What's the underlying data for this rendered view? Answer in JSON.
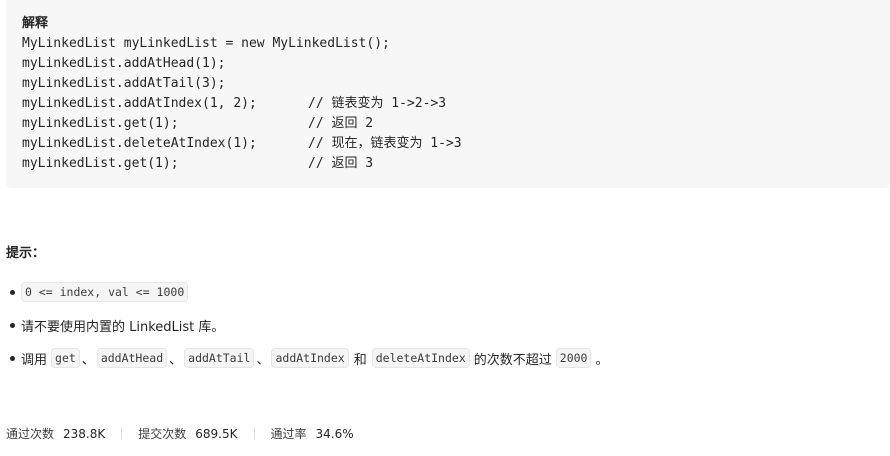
{
  "code_block": {
    "title": "解释",
    "lines": [
      {
        "code": "MyLinkedList myLinkedList = new MyLinkedList();",
        "comment": ""
      },
      {
        "code": "myLinkedList.addAtHead(1);",
        "comment": ""
      },
      {
        "code": "myLinkedList.addAtTail(3);",
        "comment": ""
      },
      {
        "code": "myLinkedList.addAtIndex(1, 2);",
        "comment": "// 链表变为 1->2->3"
      },
      {
        "code": "myLinkedList.get(1);",
        "comment": "// 返回 2"
      },
      {
        "code": "myLinkedList.deleteAtIndex(1);",
        "comment": "// 现在，链表变为 1->3"
      },
      {
        "code": "myLinkedList.get(1);",
        "comment": "// 返回 3"
      }
    ]
  },
  "hints": {
    "title": "提示：",
    "item1": {
      "code": "0 <= index, val <= 1000"
    },
    "item2": {
      "text": "请不要使用内置的 LinkedList 库。"
    },
    "item3": {
      "prefix": "调用",
      "codes": [
        "get",
        "addAtHead",
        "addAtTail",
        "addAtIndex",
        "deleteAtIndex",
        "2000"
      ],
      "sep": "、",
      "and": "和",
      "suffix_mid": "的次数不超过",
      "end": "。"
    }
  },
  "stats": {
    "accepted_label": "通过次数",
    "accepted_value": "238.8K",
    "submissions_label": "提交次数",
    "submissions_value": "689.5K",
    "rate_label": "通过率",
    "rate_value": "34.6%"
  }
}
